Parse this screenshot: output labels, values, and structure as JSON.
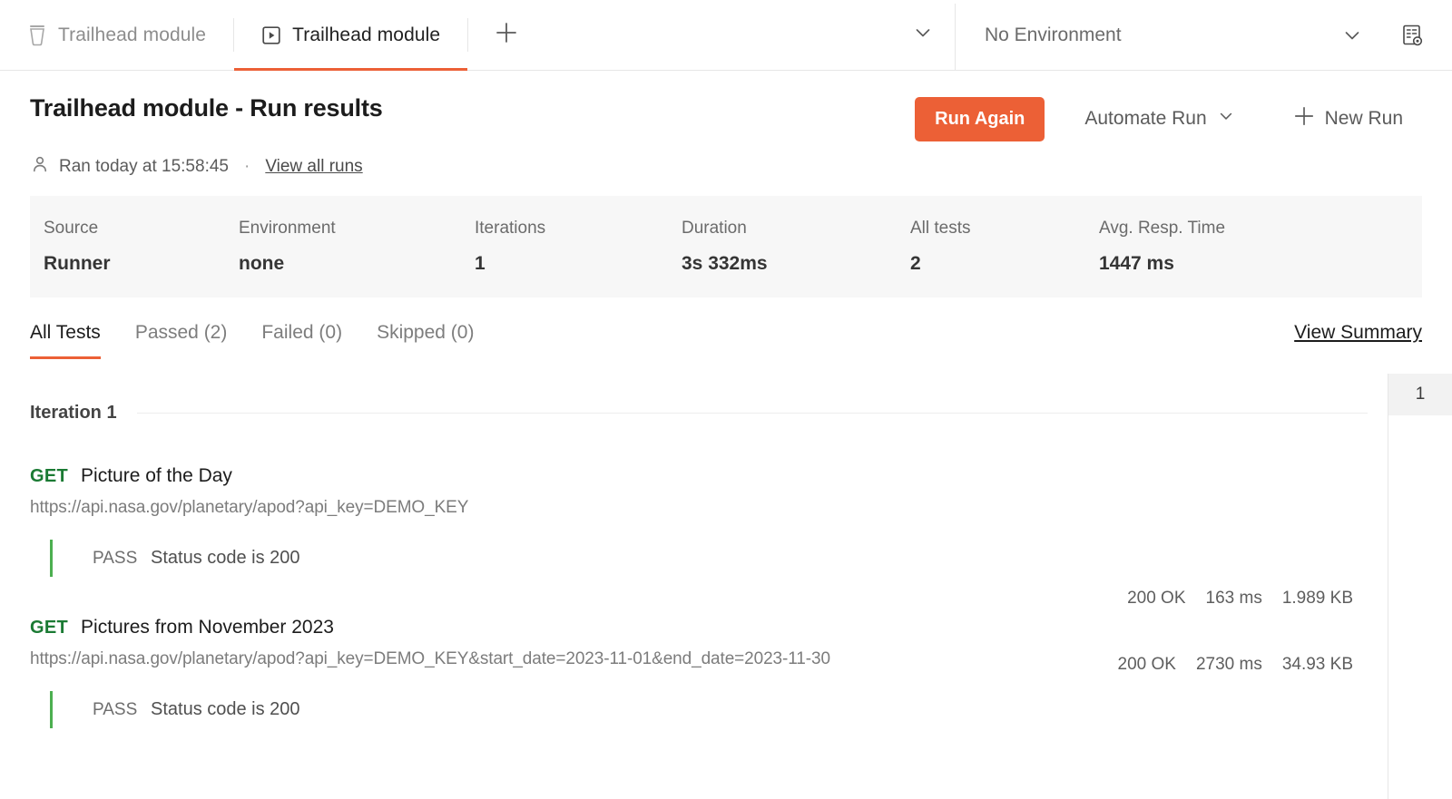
{
  "window": {
    "tabs": [
      {
        "label": "Trailhead module",
        "icon": "collection-beaker-icon",
        "active": false
      },
      {
        "label": "Trailhead module",
        "icon": "run-play-icon",
        "active": true
      }
    ],
    "add_tab_icon": "plus-icon",
    "tabs_overflow_icon": "chevron-down-icon",
    "environment": {
      "selected": "No Environment",
      "chevron_icon": "chevron-down-icon"
    },
    "console_icon": "environment-quick-look-icon"
  },
  "header": {
    "title": "Trailhead module - Run results",
    "run_again_label": "Run Again",
    "automate_run_label": "Automate Run",
    "automate_chevron_icon": "chevron-down-icon",
    "new_run_label": "New Run",
    "new_run_icon": "plus-icon",
    "meta": {
      "user_icon": "person-icon",
      "ran_at": "Ran today at 15:58:45",
      "separator": "·",
      "view_all_runs": "View all runs"
    }
  },
  "stats": [
    {
      "label": "Source",
      "value": "Runner"
    },
    {
      "label": "Environment",
      "value": "none"
    },
    {
      "label": "Iterations",
      "value": "1"
    },
    {
      "label": "Duration",
      "value": "3s 332ms"
    },
    {
      "label": "All tests",
      "value": "2"
    },
    {
      "label": "Avg. Resp. Time",
      "value": "1447 ms"
    }
  ],
  "filters": {
    "tabs": [
      {
        "label": "All Tests",
        "active": true
      },
      {
        "label": "Passed (2)",
        "active": false
      },
      {
        "label": "Failed (0)",
        "active": false
      },
      {
        "label": "Skipped (0)",
        "active": false
      }
    ],
    "view_summary": "View Summary"
  },
  "results": {
    "iteration_title": "Iteration 1",
    "requests": [
      {
        "method": "GET",
        "name": "Picture of the Day",
        "url": "https://api.nasa.gov/planetary/apod?api_key=DEMO_KEY",
        "status": "200 OK",
        "time": "163 ms",
        "size": "1.989 KB",
        "assertions": [
          {
            "status": "PASS",
            "text": "Status code is 200"
          }
        ]
      },
      {
        "method": "GET",
        "name": "Pictures from November 2023",
        "url": "https://api.nasa.gov/planetary/apod?api_key=DEMO_KEY&start_date=2023-11-01&end_date=2023-11-30",
        "status": "200 OK",
        "time": "2730 ms",
        "size": "34.93 KB",
        "assertions": [
          {
            "status": "PASS",
            "text": "Status code is 200"
          }
        ]
      }
    ]
  },
  "rail": {
    "items": [
      {
        "label": "1",
        "selected": true
      }
    ]
  },
  "colors": {
    "accent": "#ec6036",
    "pass": "#4caf50",
    "method_get": "#1a7a33"
  }
}
